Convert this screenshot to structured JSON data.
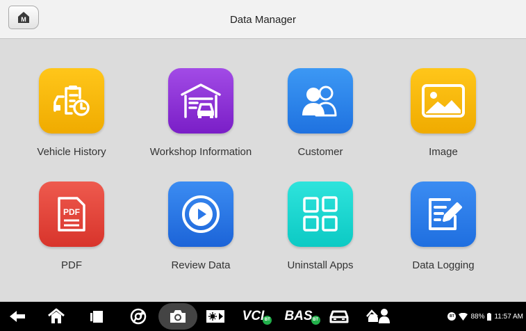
{
  "header": {
    "title": "Data Manager",
    "home_glyph": "M"
  },
  "apps": [
    {
      "label": "Vehicle History",
      "icon": "vehicle-history-icon",
      "color": "#f5b800"
    },
    {
      "label": "Workshop Information",
      "icon": "workshop-icon",
      "color": "#8c2fd6"
    },
    {
      "label": "Customer",
      "icon": "customer-icon",
      "color": "#2b86ee"
    },
    {
      "label": "Image",
      "icon": "image-icon",
      "color": "#f5b800"
    },
    {
      "label": "PDF",
      "icon": "pdf-icon",
      "color": "#e4463c"
    },
    {
      "label": "Review Data",
      "icon": "play-icon",
      "color": "#2b78e8"
    },
    {
      "label": "Uninstall Apps",
      "icon": "apps-grid-icon",
      "color": "#1ad5d0"
    },
    {
      "label": "Data Logging",
      "icon": "edit-note-icon",
      "color": "#2b86ee"
    }
  ],
  "pdf_badge": "PDF",
  "navbar": {
    "vci_label": "VCI",
    "bas_label": "BAS",
    "vci_badge": "BT",
    "bas_badge": "BT",
    "status_bt": "BT",
    "battery": "88%",
    "time": "11:57 AM"
  }
}
